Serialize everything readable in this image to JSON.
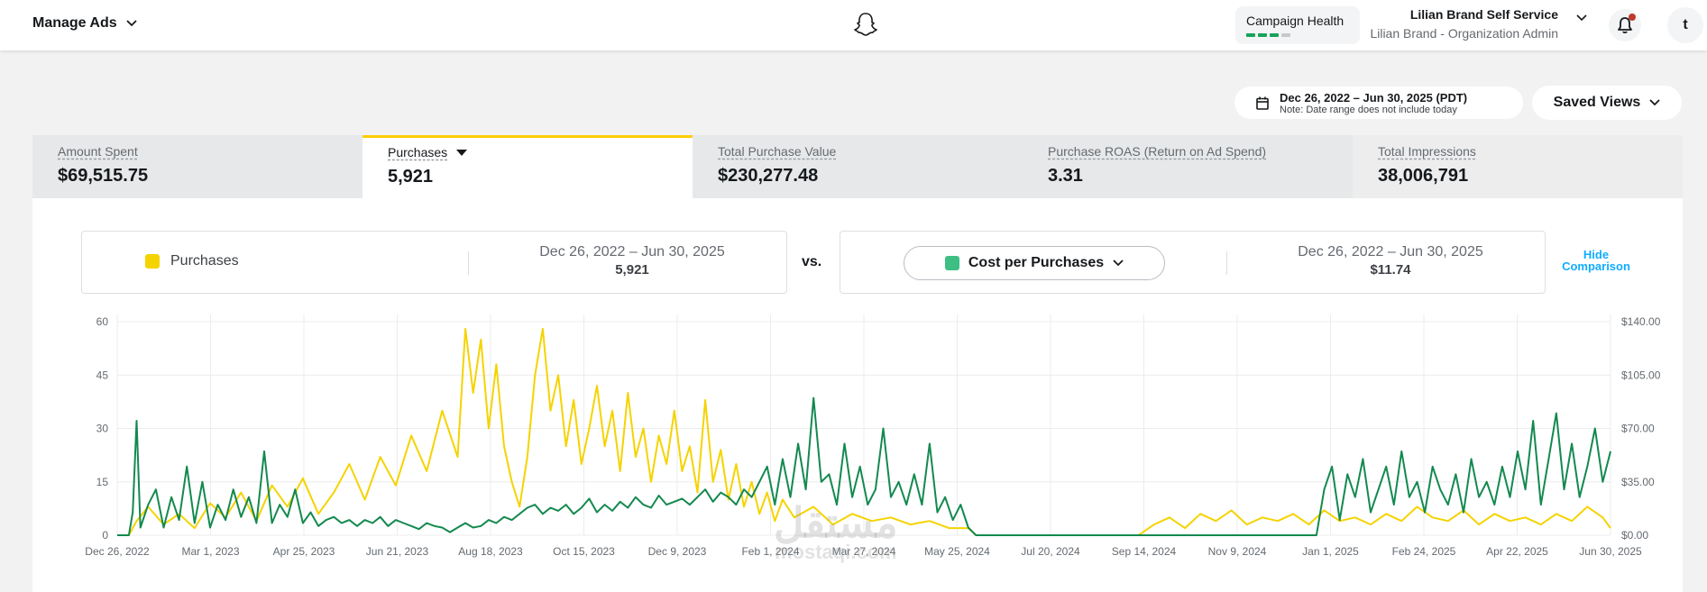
{
  "header": {
    "manage_label": "Manage Ads",
    "health_label": "Campaign Health",
    "health_bars": [
      true,
      true,
      true,
      false
    ],
    "account_name": "Lilian Brand Self Service",
    "account_role": "Lilian Brand - Organization Admin",
    "avatar_initial": "t",
    "colors": {
      "health_green": "#14a35a",
      "notification_dot": "#c0392b"
    }
  },
  "toolbar": {
    "date_range": "Dec 26, 2022 – Jun 30, 2025 (PDT)",
    "date_note": "Note: Date range does not include today",
    "saved_views_label": "Saved Views"
  },
  "metrics": [
    {
      "label": "Amount Spent",
      "value": "$69,515.75"
    },
    {
      "label": "Purchases",
      "value": "5,921"
    },
    {
      "label": "Total Purchase Value",
      "value": "$230,277.48"
    },
    {
      "label": "Purchase ROAS (Return on Ad Spend)",
      "value": "3.31"
    },
    {
      "label": "Total Impressions",
      "value": "38,006,791"
    }
  ],
  "comparison": {
    "left": {
      "metric": "Purchases",
      "range": "Dec 26, 2022 – Jun 30, 2025",
      "value": "5,921",
      "color": "#f5d300"
    },
    "vs": "vs.",
    "right": {
      "metric": "Cost per Purchases",
      "range": "Dec 26, 2022 – Jun 30, 2025",
      "value": "$11.74",
      "color": "#3dbf84"
    },
    "hide_line1": "Hide",
    "hide_line2": "Comparison"
  },
  "watermark": {
    "arabic": "مستقل",
    "latin": "mostaqi.com"
  },
  "chart_data": {
    "type": "line",
    "x_labels": [
      "Dec 26, 2022",
      "Mar 1, 2023",
      "Apr 25, 2023",
      "Jun 21, 2023",
      "Aug 18, 2023",
      "Oct 15, 2023",
      "Dec 9, 2023",
      "Feb 1, 2024",
      "Mar 27, 2024",
      "May 25, 2024",
      "Jul 20, 2024",
      "Sep 14, 2024",
      "Nov 9, 2024",
      "Jan 1, 2025",
      "Feb 24, 2025",
      "Apr 22, 2025",
      "Jun 30, 2025"
    ],
    "y_left_ticks": [
      "0",
      "15",
      "30",
      "45",
      "60"
    ],
    "y_left_range": [
      0,
      60
    ],
    "y_right_ticks": [
      "$0.00",
      "$35.00",
      "$70.00",
      "$105.00",
      "$140.00"
    ],
    "y_right_range": [
      0,
      140
    ],
    "grid": true,
    "series": [
      {
        "name": "Purchases",
        "axis": "left",
        "color": "#f5d300",
        "points": [
          [
            0,
            0
          ],
          [
            3,
            0
          ],
          [
            5,
            4
          ],
          [
            8,
            8
          ],
          [
            12,
            3
          ],
          [
            16,
            6
          ],
          [
            20,
            2
          ],
          [
            24,
            9
          ],
          [
            28,
            5
          ],
          [
            32,
            12
          ],
          [
            36,
            4
          ],
          [
            40,
            14
          ],
          [
            44,
            8
          ],
          [
            48,
            16
          ],
          [
            52,
            6
          ],
          [
            56,
            12
          ],
          [
            60,
            20
          ],
          [
            64,
            10
          ],
          [
            68,
            22
          ],
          [
            72,
            14
          ],
          [
            76,
            28
          ],
          [
            80,
            18
          ],
          [
            84,
            35
          ],
          [
            88,
            22
          ],
          [
            90,
            58
          ],
          [
            92,
            40
          ],
          [
            94,
            55
          ],
          [
            96,
            30
          ],
          [
            98,
            48
          ],
          [
            100,
            25
          ],
          [
            102,
            15
          ],
          [
            104,
            8
          ],
          [
            106,
            22
          ],
          [
            108,
            45
          ],
          [
            110,
            58
          ],
          [
            112,
            35
          ],
          [
            114,
            45
          ],
          [
            116,
            25
          ],
          [
            118,
            38
          ],
          [
            120,
            20
          ],
          [
            122,
            30
          ],
          [
            124,
            42
          ],
          [
            126,
            25
          ],
          [
            128,
            35
          ],
          [
            130,
            18
          ],
          [
            132,
            40
          ],
          [
            134,
            22
          ],
          [
            136,
            30
          ],
          [
            138,
            15
          ],
          [
            140,
            28
          ],
          [
            142,
            20
          ],
          [
            144,
            35
          ],
          [
            146,
            18
          ],
          [
            148,
            25
          ],
          [
            150,
            12
          ],
          [
            152,
            38
          ],
          [
            154,
            15
          ],
          [
            156,
            24
          ],
          [
            158,
            10
          ],
          [
            160,
            20
          ],
          [
            162,
            8
          ],
          [
            164,
            15
          ],
          [
            166,
            6
          ],
          [
            168,
            12
          ],
          [
            170,
            4
          ],
          [
            172,
            10
          ],
          [
            175,
            5
          ],
          [
            180,
            8
          ],
          [
            185,
            3
          ],
          [
            190,
            6
          ],
          [
            195,
            4
          ],
          [
            200,
            5
          ],
          [
            205,
            3
          ],
          [
            210,
            4
          ],
          [
            215,
            2
          ],
          [
            220,
            2
          ],
          [
            222,
            0
          ],
          [
            225,
            0
          ],
          [
            264,
            0
          ],
          [
            268,
            3
          ],
          [
            272,
            5
          ],
          [
            276,
            2
          ],
          [
            280,
            6
          ],
          [
            284,
            4
          ],
          [
            288,
            7
          ],
          [
            292,
            3
          ],
          [
            296,
            5
          ],
          [
            300,
            4
          ],
          [
            304,
            6
          ],
          [
            308,
            3
          ],
          [
            312,
            7
          ],
          [
            316,
            4
          ],
          [
            320,
            5
          ],
          [
            324,
            3
          ],
          [
            328,
            6
          ],
          [
            332,
            4
          ],
          [
            336,
            8
          ],
          [
            340,
            5
          ],
          [
            344,
            4
          ],
          [
            348,
            7
          ],
          [
            352,
            3
          ],
          [
            356,
            6
          ],
          [
            360,
            4
          ],
          [
            364,
            5
          ],
          [
            368,
            3
          ],
          [
            372,
            6
          ],
          [
            376,
            4
          ],
          [
            380,
            8
          ],
          [
            384,
            5
          ],
          [
            386,
            2
          ]
        ]
      },
      {
        "name": "Cost per Purchases",
        "axis": "right",
        "color": "#13894f",
        "points": [
          [
            0,
            0
          ],
          [
            3,
            0
          ],
          [
            4,
            15
          ],
          [
            5,
            75
          ],
          [
            6,
            5
          ],
          [
            8,
            20
          ],
          [
            10,
            30
          ],
          [
            12,
            5
          ],
          [
            14,
            25
          ],
          [
            16,
            10
          ],
          [
            18,
            45
          ],
          [
            20,
            8
          ],
          [
            22,
            35
          ],
          [
            24,
            5
          ],
          [
            26,
            20
          ],
          [
            28,
            10
          ],
          [
            30,
            30
          ],
          [
            32,
            12
          ],
          [
            34,
            25
          ],
          [
            36,
            8
          ],
          [
            38,
            55
          ],
          [
            40,
            8
          ],
          [
            42,
            20
          ],
          [
            44,
            12
          ],
          [
            46,
            30
          ],
          [
            48,
            8
          ],
          [
            50,
            15
          ],
          [
            52,
            6
          ],
          [
            54,
            10
          ],
          [
            56,
            12
          ],
          [
            58,
            8
          ],
          [
            60,
            10
          ],
          [
            62,
            6
          ],
          [
            64,
            10
          ],
          [
            66,
            8
          ],
          [
            68,
            12
          ],
          [
            70,
            6
          ],
          [
            72,
            10
          ],
          [
            74,
            8
          ],
          [
            76,
            6
          ],
          [
            78,
            4
          ],
          [
            80,
            8
          ],
          [
            82,
            6
          ],
          [
            84,
            5
          ],
          [
            86,
            2
          ],
          [
            88,
            5
          ],
          [
            90,
            8
          ],
          [
            92,
            5
          ],
          [
            94,
            6
          ],
          [
            96,
            10
          ],
          [
            98,
            8
          ],
          [
            100,
            12
          ],
          [
            102,
            10
          ],
          [
            104,
            14
          ],
          [
            106,
            18
          ],
          [
            108,
            20
          ],
          [
            110,
            14
          ],
          [
            112,
            18
          ],
          [
            114,
            16
          ],
          [
            116,
            20
          ],
          [
            118,
            14
          ],
          [
            120,
            18
          ],
          [
            122,
            24
          ],
          [
            124,
            15
          ],
          [
            126,
            20
          ],
          [
            128,
            16
          ],
          [
            130,
            22
          ],
          [
            132,
            18
          ],
          [
            134,
            25
          ],
          [
            136,
            20
          ],
          [
            138,
            18
          ],
          [
            140,
            26
          ],
          [
            142,
            20
          ],
          [
            144,
            22
          ],
          [
            146,
            24
          ],
          [
            148,
            20
          ],
          [
            150,
            25
          ],
          [
            152,
            30
          ],
          [
            154,
            22
          ],
          [
            156,
            28
          ],
          [
            158,
            25
          ],
          [
            160,
            20
          ],
          [
            162,
            30
          ],
          [
            164,
            25
          ],
          [
            166,
            35
          ],
          [
            168,
            45
          ],
          [
            170,
            20
          ],
          [
            172,
            50
          ],
          [
            174,
            25
          ],
          [
            176,
            60
          ],
          [
            178,
            30
          ],
          [
            180,
            90
          ],
          [
            182,
            35
          ],
          [
            184,
            40
          ],
          [
            186,
            20
          ],
          [
            188,
            60
          ],
          [
            190,
            25
          ],
          [
            192,
            45
          ],
          [
            194,
            20
          ],
          [
            196,
            30
          ],
          [
            198,
            70
          ],
          [
            200,
            25
          ],
          [
            202,
            35
          ],
          [
            204,
            20
          ],
          [
            206,
            40
          ],
          [
            208,
            20
          ],
          [
            210,
            60
          ],
          [
            212,
            15
          ],
          [
            214,
            25
          ],
          [
            216,
            10
          ],
          [
            218,
            20
          ],
          [
            220,
            5
          ],
          [
            222,
            0
          ],
          [
            225,
            0
          ],
          [
            310,
            0
          ],
          [
            312,
            30
          ],
          [
            314,
            45
          ],
          [
            316,
            10
          ],
          [
            318,
            40
          ],
          [
            320,
            25
          ],
          [
            322,
            50
          ],
          [
            324,
            15
          ],
          [
            326,
            30
          ],
          [
            328,
            45
          ],
          [
            330,
            20
          ],
          [
            332,
            55
          ],
          [
            334,
            25
          ],
          [
            336,
            35
          ],
          [
            338,
            15
          ],
          [
            340,
            45
          ],
          [
            342,
            30
          ],
          [
            344,
            20
          ],
          [
            346,
            40
          ],
          [
            348,
            15
          ],
          [
            350,
            50
          ],
          [
            352,
            25
          ],
          [
            354,
            35
          ],
          [
            356,
            20
          ],
          [
            358,
            45
          ],
          [
            360,
            25
          ],
          [
            362,
            55
          ],
          [
            364,
            30
          ],
          [
            366,
            75
          ],
          [
            368,
            20
          ],
          [
            370,
            50
          ],
          [
            372,
            80
          ],
          [
            374,
            30
          ],
          [
            376,
            60
          ],
          [
            378,
            25
          ],
          [
            380,
            45
          ],
          [
            382,
            70
          ],
          [
            384,
            35
          ],
          [
            386,
            55
          ]
        ]
      }
    ],
    "x_max": 386
  }
}
